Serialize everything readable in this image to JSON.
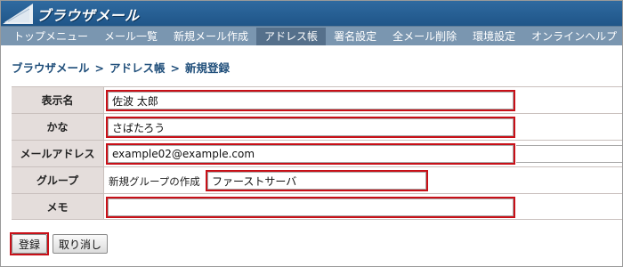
{
  "app": {
    "title": "ブラウザメール"
  },
  "nav": {
    "items": [
      {
        "label": "トップメニュー",
        "active": false
      },
      {
        "label": "メール一覧",
        "active": false
      },
      {
        "label": "新規メール作成",
        "active": false
      },
      {
        "label": "アドレス帳",
        "active": true
      },
      {
        "label": "署名設定",
        "active": false
      },
      {
        "label": "全メール削除",
        "active": false
      },
      {
        "label": "環境設定",
        "active": false
      },
      {
        "label": "オンラインヘルプ",
        "active": false
      }
    ]
  },
  "breadcrumb": {
    "items": [
      "ブラウザメール",
      "アドレス帳",
      "新規登録"
    ],
    "separator": ">"
  },
  "form": {
    "display_name": {
      "label": "表示名",
      "value": "佐波 太郎"
    },
    "kana": {
      "label": "かな",
      "value": "さばたろう"
    },
    "email": {
      "label": "メールアドレス",
      "value": "example02@example.com"
    },
    "group": {
      "label": "グループ",
      "prefix": "新規グループの作成",
      "value": "ファーストサーバ"
    },
    "memo": {
      "label": "メモ",
      "value": ""
    }
  },
  "buttons": {
    "register": "登録",
    "cancel": "取り消し"
  },
  "colors": {
    "header": "#1f5588",
    "nav": "#7a96b0",
    "highlight": "#c81018",
    "label_bg": "#e4dddb"
  }
}
